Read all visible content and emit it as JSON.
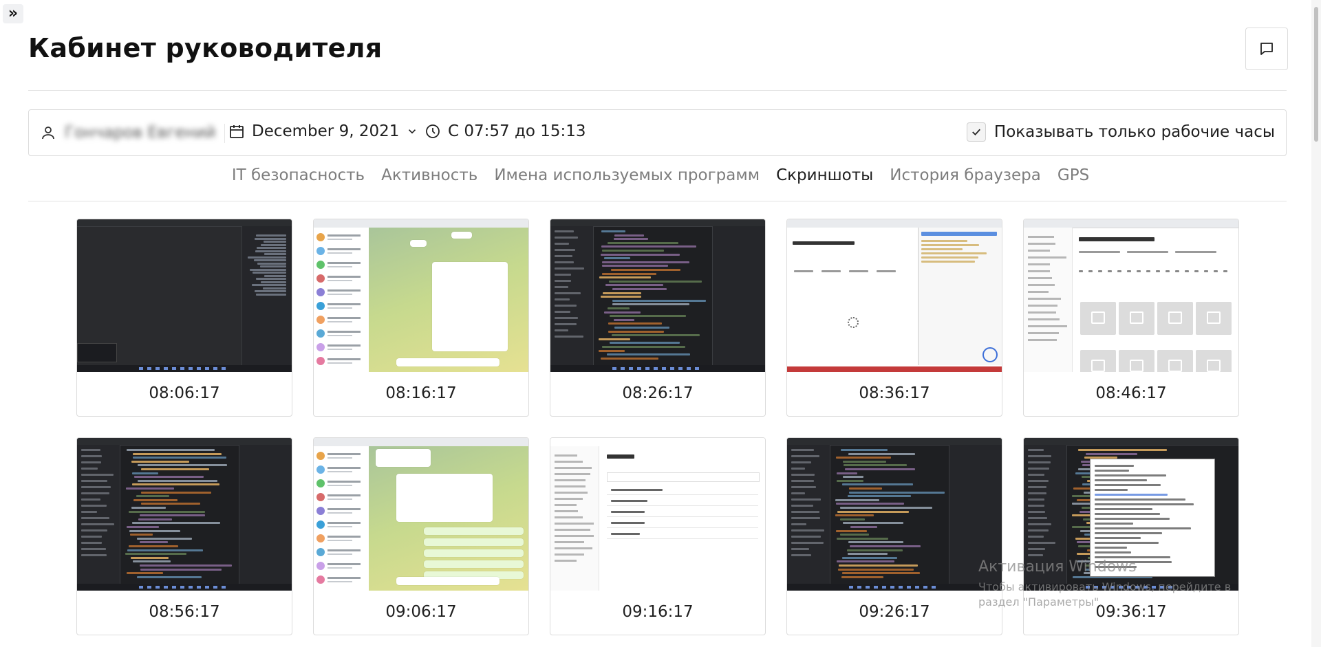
{
  "header": {
    "expand_icon": "double-chevron-right-icon",
    "title": "Кабинет руководителя",
    "chat_icon": "chat-bubble-icon"
  },
  "filters": {
    "user_icon": "user-icon",
    "user_name": "Гончаров Евгений",
    "date_icon": "calendar-icon",
    "date": "December 9, 2021",
    "date_dropdown_icon": "chevron-down-icon",
    "time_icon": "clock-icon",
    "time_range": "С 07:57 до 15:13",
    "work_hours_checked": true,
    "work_hours_label": "Показывать только рабочие часы"
  },
  "tabs": [
    {
      "label": "IT безопасность",
      "active": false
    },
    {
      "label": "Активность",
      "active": false
    },
    {
      "label": "Имена используемых программ",
      "active": false
    },
    {
      "label": "Скриншоты",
      "active": true
    },
    {
      "label": "История браузера",
      "active": false
    },
    {
      "label": "GPS",
      "active": false
    }
  ],
  "screenshots": [
    {
      "time": "08:06:17",
      "kind": "dark"
    },
    {
      "time": "08:16:17",
      "kind": "telegram"
    },
    {
      "time": "08:26:17",
      "kind": "ide"
    },
    {
      "time": "08:36:17",
      "kind": "browser"
    },
    {
      "time": "08:46:17",
      "kind": "app-grid"
    },
    {
      "time": "08:56:17",
      "kind": "ide"
    },
    {
      "time": "09:06:17",
      "kind": "telegram"
    },
    {
      "time": "09:16:17",
      "kind": "app-list"
    },
    {
      "time": "09:26:17",
      "kind": "ide"
    },
    {
      "time": "09:36:17",
      "kind": "terminal"
    }
  ],
  "os_watermark": {
    "title": "Активация Windows",
    "subtitle": "Чтобы активировать Windows, перейдите в раздел \"Параметры\"."
  },
  "colors": {
    "accent_text": "#1f1f1f",
    "inactive_tab": "#7d7d7d",
    "border": "#dcdcdc"
  }
}
